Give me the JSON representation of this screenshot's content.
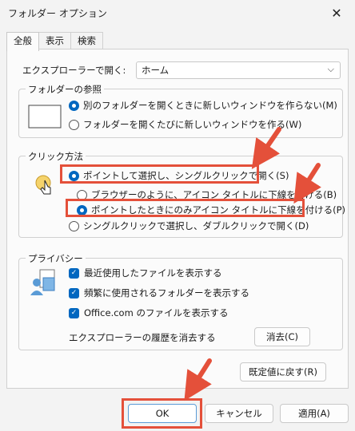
{
  "window": {
    "title": "フォルダー オプション",
    "close_glyph": "✕"
  },
  "tabs": [
    {
      "label": "全般",
      "active": true
    },
    {
      "label": "表示",
      "active": false
    },
    {
      "label": "検索",
      "active": false
    }
  ],
  "open_explorer": {
    "label": "エクスプローラーで開く:",
    "value": "ホーム"
  },
  "browse_folders": {
    "title": "フォルダーの参照",
    "options": [
      {
        "label": "別のフォルダーを開くときに新しいウィンドウを作らない(M)",
        "selected": true
      },
      {
        "label": "フォルダーを開くたびに新しいウィンドウを作る(W)",
        "selected": false
      }
    ]
  },
  "click_method": {
    "title": "クリック方法",
    "options": [
      {
        "label": "ポイントして選択し、シングルクリックで開く(S)",
        "selected": true
      },
      {
        "label": "ブラウザーのように、アイコン タイトルに下線を付ける(B)",
        "selected": false
      },
      {
        "label": "ポイントしたときにのみアイコン タイトルに下線を付ける(P)",
        "selected": true
      },
      {
        "label": "シングルクリックで選択し、ダブルクリックで開く(D)",
        "selected": false
      }
    ]
  },
  "privacy": {
    "title": "プライバシー",
    "checks": [
      {
        "label": "最近使用したファイルを表示する",
        "checked": true
      },
      {
        "label": "頻繁に使用されるフォルダーを表示する",
        "checked": true
      },
      {
        "label": "Office.com のファイルを表示する",
        "checked": true
      }
    ],
    "clear_label": "エクスプローラーの履歴を消去する",
    "clear_button": "消去(C)"
  },
  "restore_defaults": "既定値に戻す(R)",
  "footer": {
    "ok": "OK",
    "cancel": "キャンセル",
    "apply": "適用(A)"
  },
  "colors": {
    "accent": "#0067c0",
    "annotation": "#e4503a"
  }
}
